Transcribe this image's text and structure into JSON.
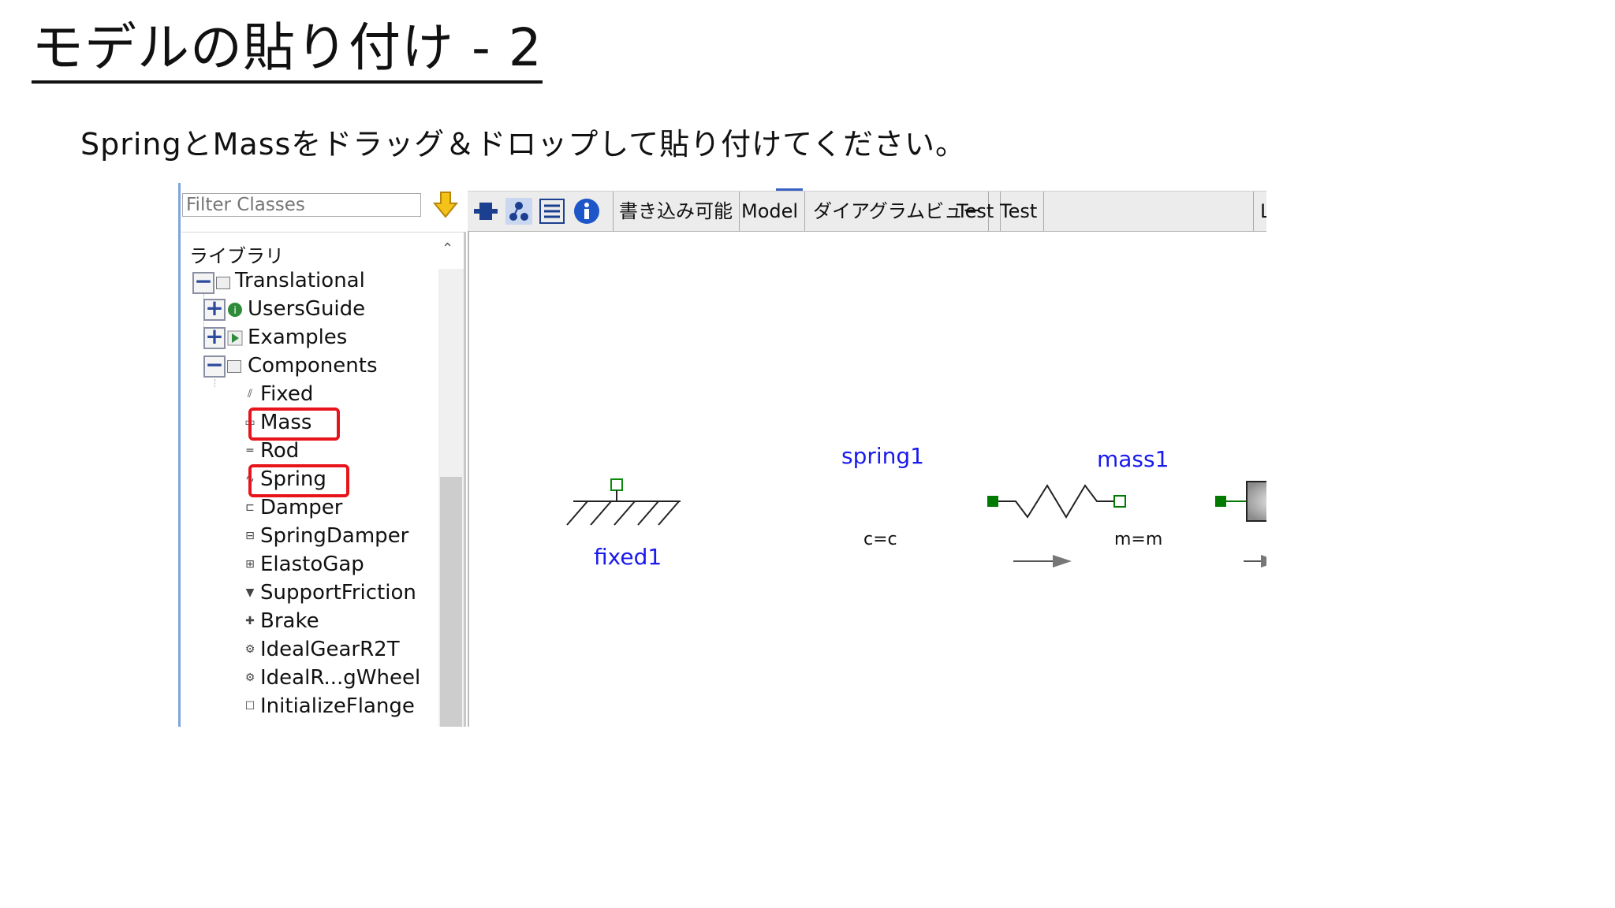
{
  "slide": {
    "title": "モデルの貼り付け - 2",
    "instruction": "SpringとMassをドラッグ＆ドロップして貼り付けてください。"
  },
  "library": {
    "filter_placeholder": "Filter Classes",
    "title": "ライブラリ",
    "root": {
      "label": "Translational",
      "expanded": true
    },
    "groups": [
      {
        "label": "UsersGuide",
        "expanded": false
      },
      {
        "label": "Examples",
        "expanded": false
      },
      {
        "label": "Components",
        "expanded": true
      }
    ],
    "components": [
      {
        "label": "Fixed",
        "highlighted": false
      },
      {
        "label": "Mass",
        "highlighted": true
      },
      {
        "label": "Rod",
        "highlighted": false
      },
      {
        "label": "Spring",
        "highlighted": true
      },
      {
        "label": "Damper",
        "highlighted": false
      },
      {
        "label": "SpringDamper",
        "highlighted": false
      },
      {
        "label": "ElastoGap",
        "highlighted": false
      },
      {
        "label": "SupportFriction",
        "highlighted": false
      },
      {
        "label": "Brake",
        "highlighted": false
      },
      {
        "label": "IdealGearR2T",
        "highlighted": false
      },
      {
        "label": "IdealR...gWheel",
        "highlighted": false
      },
      {
        "label": "InitializeFlange",
        "highlighted": false
      }
    ]
  },
  "toolbar": {
    "icons": [
      "icon-view-icon",
      "diagram-view-icon",
      "text-view-icon",
      "info-icon"
    ],
    "writable": "書き込み可能",
    "model": "Model",
    "diagram_view": "ダイアグラムビュー",
    "test1": "Test",
    "test2": "Test",
    "cut_label": "L"
  },
  "diagram": {
    "fixed": {
      "name": "fixed1"
    },
    "spring": {
      "name": "spring1",
      "param": "c=c"
    },
    "mass": {
      "name": "mass1",
      "param": "m=m"
    }
  },
  "colors": {
    "highlight": "#e8141b",
    "component_name": "#1a1aee",
    "connector": "#007a00",
    "scrollbar_thumb": "#cdcdcd"
  }
}
